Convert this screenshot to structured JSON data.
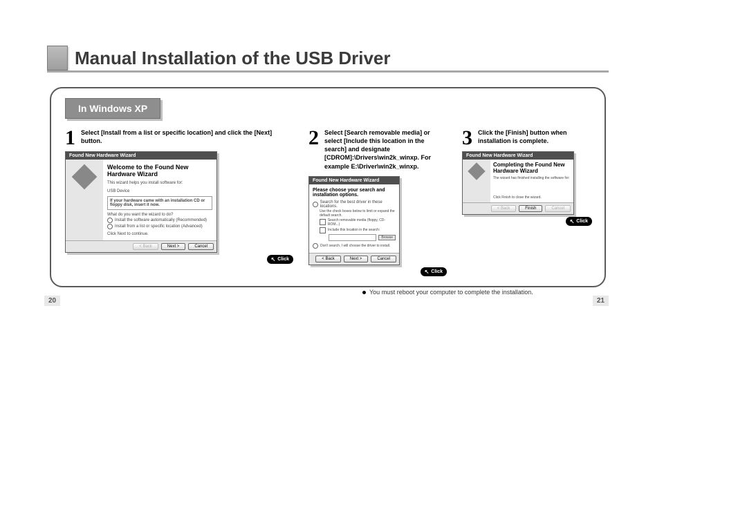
{
  "title": "Manual Installation of the USB Driver",
  "badge": "In Windows XP",
  "steps": {
    "s1": {
      "num": "1",
      "text": "Select [Install from a list or specific location] and click the [Next] button.",
      "wizard": {
        "titlebar": "Found New Hardware Wizard",
        "heading": "Welcome to the Found New Hardware Wizard",
        "sub": "This wizard helps you install software for:",
        "device": "USB Device",
        "cdnote": "If your hardware came with an installation CD or floppy disk, insert it now.",
        "question": "What do you want the wizard to do?",
        "opt1": "Install the software automatically (Recommended)",
        "opt2": "Install from a list or specific location (Advanced)",
        "hint": "Click Next to continue.",
        "back": "< Back",
        "next": "Next >",
        "cancel": "Cancel"
      },
      "click": "Click"
    },
    "s2": {
      "num": "2",
      "text": "Select [Search removable media] or select [Include this location in the search] and designate [CDROM]:\\Drivers\\win2k_winxp. For example E:\\Driver\\win2k_winxp.",
      "wizard": {
        "titlebar": "Found New Hardware Wizard",
        "heading": "Please choose your search and installation options.",
        "opt_a": "Search for the best driver in these locations.",
        "sub_a": "Use the check boxes below to limit or expand the default search.",
        "chk1": "Search removable media (floppy, CD-ROM...)",
        "chk2": "Include this location in the search:",
        "browse": "Browse",
        "opt_b": "Don't search. I will choose the driver to install.",
        "back": "< Back",
        "next": "Next >",
        "cancel": "Cancel"
      },
      "click": "Click"
    },
    "s3": {
      "num": "3",
      "text": "Click the [Finish] button when installation is complete.",
      "wizard": {
        "titlebar": "Found New Hardware Wizard",
        "heading": "Completing the Found New Hardware Wizard",
        "sub": "The wizard has finished installing the software for:",
        "hint": "Click Finish to close the wizard.",
        "back": "< Back",
        "finish": "Finish",
        "cancel": "Cancel"
      },
      "click": "Click"
    }
  },
  "footnote": "You must reboot your computer to complete the installation.",
  "page_left": "20",
  "page_right": "21"
}
